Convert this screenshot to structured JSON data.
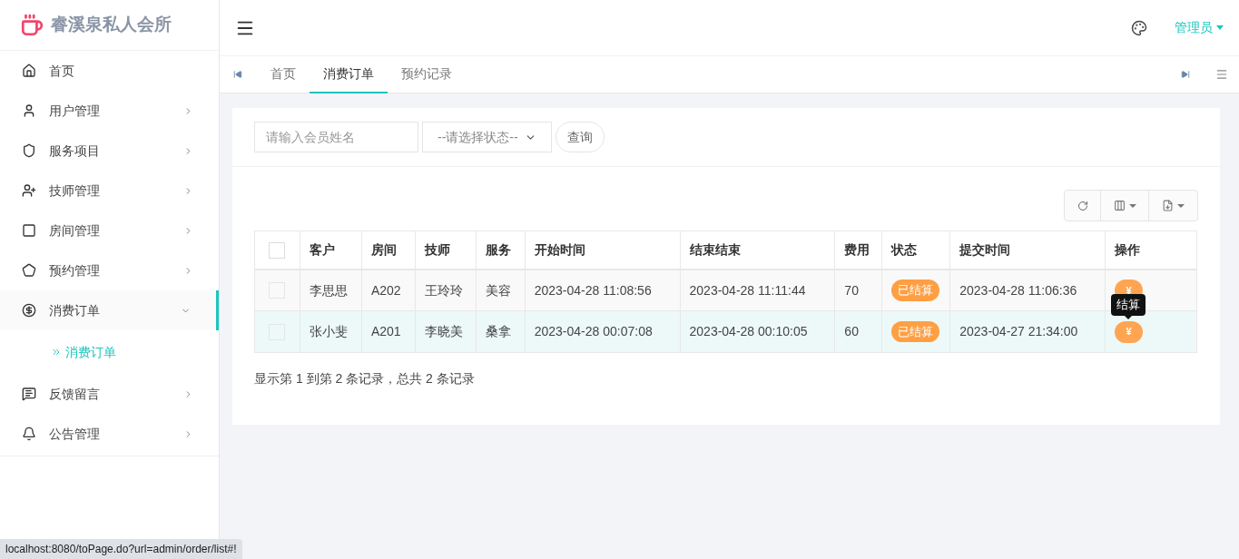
{
  "brand": {
    "name": "睿溪泉私人会所"
  },
  "sidebar": {
    "items": [
      {
        "label": "首页",
        "kind": "link",
        "selected": false
      },
      {
        "label": "用户管理",
        "kind": "menu",
        "selected": false,
        "expanded": false
      },
      {
        "label": "服务项目",
        "kind": "menu",
        "selected": false,
        "expanded": false
      },
      {
        "label": "技师管理",
        "kind": "menu",
        "selected": false,
        "expanded": false
      },
      {
        "label": "房间管理",
        "kind": "menu",
        "selected": false,
        "expanded": false
      },
      {
        "label": "预约管理",
        "kind": "menu",
        "selected": false,
        "expanded": false
      },
      {
        "label": "消费订单",
        "kind": "menu",
        "selected": true,
        "expanded": true,
        "children": [
          {
            "label": "消费订单",
            "selected": true
          }
        ]
      },
      {
        "label": "反馈留言",
        "kind": "menu",
        "selected": false,
        "expanded": false
      },
      {
        "label": "公告管理",
        "kind": "menu",
        "selected": false,
        "expanded": false
      }
    ]
  },
  "header": {
    "user": "管理员"
  },
  "tabs": [
    {
      "label": "首页",
      "selected": false
    },
    {
      "label": "消费订单",
      "selected": true
    },
    {
      "label": "预约记录",
      "selected": false
    }
  ],
  "search": {
    "placeholder": "请输入会员姓名",
    "status_select": "--请选择状态--",
    "button": "查询"
  },
  "table": {
    "select_all_checked": false,
    "columns": [
      "客户",
      "房间",
      "技师",
      "服务",
      "开始时间",
      "结束结束",
      "费用",
      "状态",
      "提交时间",
      "操作"
    ],
    "rows": [
      {
        "checked": false,
        "highlighted": false,
        "cells": [
          "李思思",
          "A202",
          "王玲玲",
          "美容",
          "2023-04-28 11:08:56",
          "2023-04-28 11:11:44",
          "70"
        ],
        "status": "已结算",
        "submitted": "2023-04-28 11:06:36",
        "action": "¥"
      },
      {
        "checked": false,
        "highlighted": true,
        "cells": [
          "张小斐",
          "A201",
          "李晓美",
          "桑拿",
          "2023-04-28 00:07:08",
          "2023-04-28 00:10:05",
          "60"
        ],
        "status": "已结算",
        "submitted": "2023-04-27 21:34:00",
        "action": "¥"
      }
    ],
    "tooltip": "结算",
    "footer": "显示第 1 到第 2 条记录，总共 2 条记录"
  },
  "status_bar": "localhost:8080/toPage.do?url=admin/order/list#!"
}
